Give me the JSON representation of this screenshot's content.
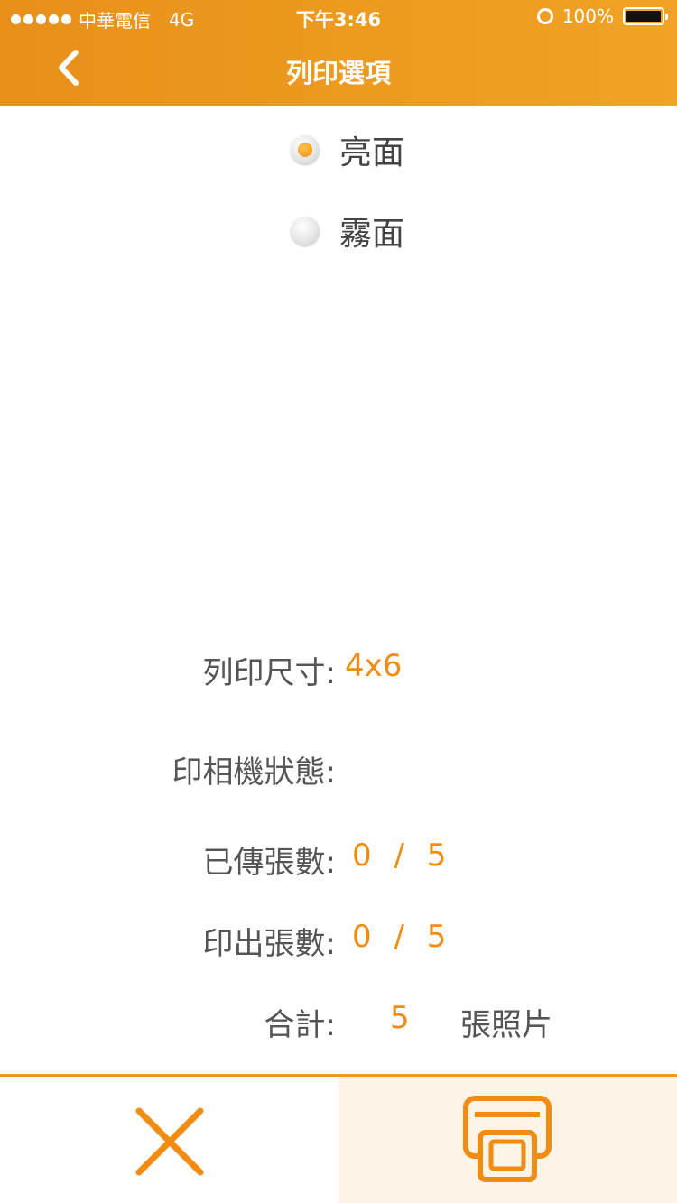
{
  "status_bar": {
    "carrier": "中華電信",
    "network": "4G",
    "time": "下午3:46",
    "battery": "100%"
  },
  "nav": {
    "title": "列印選項",
    "back_icon": "chevron-left-icon"
  },
  "finish_options": [
    {
      "label": "亮面",
      "selected": true
    },
    {
      "label": "霧面",
      "selected": false
    }
  ],
  "print_info": {
    "size_label": "列印尺寸:",
    "size_value": "4x6",
    "printer_status_label": "印相機狀態:",
    "sent_label": "已傳張數:",
    "sent_value": "0 / 5",
    "printed_label": "印出張數:",
    "printed_value": "0 / 5",
    "total_label": "合計:",
    "total_value": "5",
    "total_unit": "張照片"
  },
  "footer": {
    "cancel_icon": "close-icon",
    "print_icon": "printer-icon"
  },
  "colors": {
    "accent": "#f08c12",
    "header_start": "#e8901a",
    "header_end": "#f0a325",
    "print_button_bg": "#fdf3e6"
  }
}
